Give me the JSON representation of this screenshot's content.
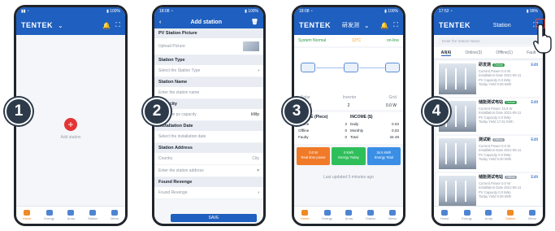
{
  "colors": {
    "brand_blue": "#1f5fbf",
    "accent_red": "#e43434",
    "step_badge": "#2d3a4a",
    "active_nav": "#f08a24"
  },
  "steps": [
    "1",
    "2",
    "3",
    "4"
  ],
  "brand": "TENTEK",
  "bottom_nav": [
    "Home",
    "Energy",
    "Array",
    "Station",
    "Menu"
  ],
  "screen1": {
    "add_icon": "+",
    "add_label": "Add station"
  },
  "screen2": {
    "title": "Add station",
    "sections": {
      "picture": "PV Station Picture",
      "type": "Station Type",
      "name": "Station Name",
      "capacity": "Capacity",
      "date": "Installation Date",
      "address": "Station Address",
      "revenue": "Found Revenge"
    },
    "fields": {
      "upload": "Upload Picture",
      "type": "Select the Station Type",
      "name": "Enter the station name",
      "capacity": "Enter the pv capacity",
      "capacity_unit": "kWp",
      "date": "Select the installation date",
      "country": "Country",
      "city": "City",
      "address": "Enter the station address",
      "revenue": "Found Revenge"
    },
    "save": "SAVE"
  },
  "screen3": {
    "station": "研发测",
    "system_status": "System Normal",
    "weather": "13°C",
    "weather_city": "Birmingham",
    "online": "on-line",
    "labels": {
      "solar": "Solar",
      "inverter": "Inverter",
      "grid": "Grid"
    },
    "values": {
      "solar": "0.0 W",
      "inverter": "2",
      "grid": "0.0 W"
    },
    "device": {
      "title": "DEVICE",
      "unit": "(Piece)",
      "rows": [
        [
          "Online",
          "2"
        ],
        [
          "Offline",
          "0"
        ],
        [
          "Faulty",
          "0"
        ]
      ]
    },
    "income": {
      "title": "INCOME",
      "unit": "($)",
      "rows": [
        [
          "Daily",
          "0.03"
        ],
        [
          "Monthly",
          "0.03"
        ],
        [
          "Total",
          "34.49"
        ]
      ]
    },
    "tiles": [
      {
        "value": "0.0 W",
        "label": "Real time power",
        "color": "#f07a28"
      },
      {
        "value": "0 kWh",
        "label": "Energy Today",
        "color": "#2fbf5a"
      },
      {
        "value": "34.5 kWh",
        "label": "Energy Total",
        "color": "#3a8ee6"
      }
    ],
    "updated": "Last updated 5 minutes ago"
  },
  "screen4": {
    "title": "Station",
    "search_placeholder": "Enter the Station Name",
    "tabs": [
      "All(4)",
      "Online(3)",
      "Offline(1)",
      "Fault"
    ],
    "card_fields": [
      "Current Power",
      "Installation Date",
      "PV Capacity",
      "Today Yield"
    ],
    "edit": "Edit",
    "stations": [
      {
        "name": "研发测",
        "status": "Online",
        "values": [
          "0.0 W",
          "2021-06-11",
          "0.0 kWp",
          "0.00 kWh"
        ]
      },
      {
        "name": "储能测试电站",
        "status": "Online",
        "values": [
          "15.8 W",
          "2021-06-11",
          "0.0 kWp",
          "17.81 kWh"
        ]
      },
      {
        "name": "测试新",
        "status": "Offline",
        "values": [
          "0.0 W",
          "2021-06-11",
          "0.0 kWp",
          "0.00 kWh"
        ]
      },
      {
        "name": "储能测试电站",
        "status": "Offline",
        "values": [
          "0.0 W",
          "2021-06-11",
          "0.0 kWp",
          "0.00 kWh"
        ]
      }
    ]
  }
}
